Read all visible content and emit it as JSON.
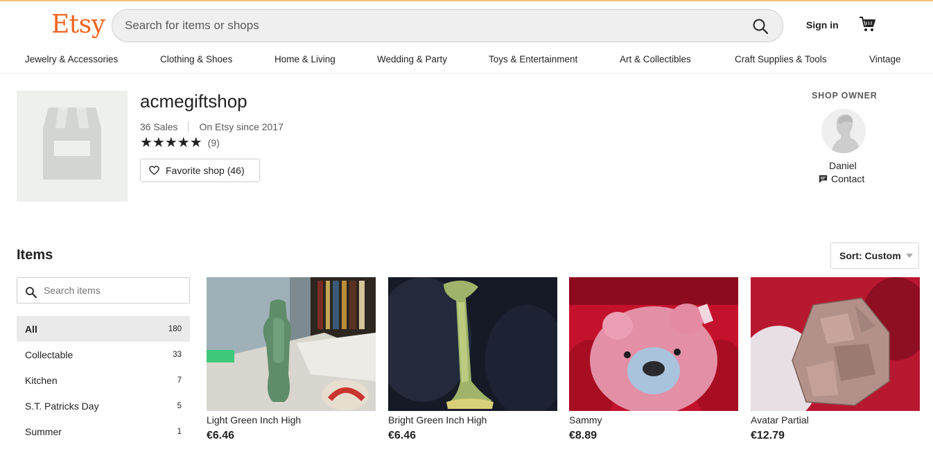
{
  "header": {
    "logo": "Etsy",
    "search_placeholder": "Search for items or shops",
    "sign_in": "Sign in"
  },
  "categories_nav": [
    "Jewelry & Accessories",
    "Clothing & Shoes",
    "Home & Living",
    "Wedding & Party",
    "Toys & Entertainment",
    "Art & Collectibles",
    "Craft Supplies & Tools",
    "Vintage"
  ],
  "shop": {
    "name": "acmegiftshop",
    "sales": "36 Sales",
    "since": "On Etsy since 2017",
    "stars": "★★★★★",
    "rating_value": 5,
    "review_count": "(9)",
    "favorite_label": "Favorite shop (46)"
  },
  "owner": {
    "label": "SHOP OWNER",
    "name": "Daniel",
    "contact": "Contact"
  },
  "items": {
    "title": "Items",
    "sort_label": "Sort: Custom",
    "search_placeholder": "Search items",
    "sections": [
      {
        "label": "All",
        "count": "180",
        "active": true
      },
      {
        "label": "Collectable",
        "count": "33"
      },
      {
        "label": "Kitchen",
        "count": "7"
      },
      {
        "label": "S.T. Patricks Day",
        "count": "5"
      },
      {
        "label": "Summer",
        "count": "1"
      }
    ],
    "listings": [
      {
        "title": "Light Green Inch High",
        "price": "€6.46"
      },
      {
        "title": "Bright Green Inch High",
        "price": "€6.46"
      },
      {
        "title": "Sammy",
        "price": "€8.89"
      },
      {
        "title": "Avatar Partial",
        "price": "€12.79"
      }
    ]
  },
  "colors": {
    "brand": "#f1641e",
    "text": "#222222"
  }
}
